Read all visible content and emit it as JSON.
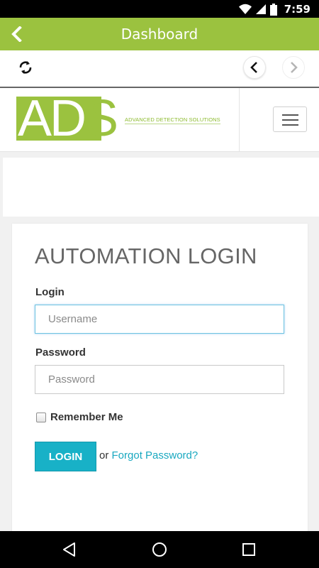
{
  "status_bar": {
    "time": "7:59"
  },
  "app_bar": {
    "title": "Dashboard"
  },
  "logo": {
    "letters_ad": "AD",
    "letter_s": "S",
    "tagline": "ADVANCED DETECTION SOLUTIONS"
  },
  "login": {
    "title": "AUTOMATION LOGIN",
    "login_label": "Login",
    "username_placeholder": "Username",
    "password_label": "Password",
    "password_placeholder": "Password",
    "remember_label": "Remember Me",
    "button_label": "LOGIN",
    "or_text": "or",
    "forgot_link": "Forgot Password?"
  },
  "icons": {
    "status": [
      "wifi-icon",
      "signal-icon",
      "battery-icon"
    ],
    "toolbar": [
      "refresh-icon",
      "chevron-left-icon",
      "chevron-right-icon"
    ],
    "nav": [
      "nav-back-icon",
      "nav-home-icon",
      "nav-recents-icon"
    ]
  },
  "colors": {
    "brand_green": "#9bc23f",
    "accent_teal": "#18b1c7",
    "link_teal": "#19a8c0"
  }
}
